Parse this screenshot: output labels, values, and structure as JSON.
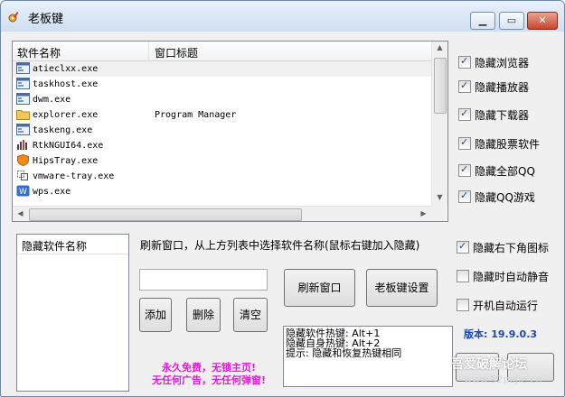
{
  "window": {
    "title": "老板键"
  },
  "process_list": {
    "columns": [
      "软件名称",
      "窗口标题"
    ],
    "rows": [
      {
        "name": "atieclxx.exe",
        "title": "",
        "icon": "app-window-icon"
      },
      {
        "name": "taskhost.exe",
        "title": "",
        "icon": "app-window-icon"
      },
      {
        "name": "dwm.exe",
        "title": "",
        "icon": "app-window-icon"
      },
      {
        "name": "explorer.exe",
        "title": "Program Manager",
        "icon": "folder-icon"
      },
      {
        "name": "taskeng.exe",
        "title": "",
        "icon": "app-window-icon"
      },
      {
        "name": "RtkNGUI64.exe",
        "title": "",
        "icon": "audio-icon"
      },
      {
        "name": "HipsTray.exe",
        "title": "",
        "icon": "shield-icon"
      },
      {
        "name": "vmware-tray.exe",
        "title": "",
        "icon": "vmware-icon"
      },
      {
        "name": "wps.exe",
        "title": "",
        "icon": "wps-icon"
      }
    ]
  },
  "options": {
    "hide_browser": {
      "label": "隐藏浏览器",
      "checked": true
    },
    "hide_player": {
      "label": "隐藏播放器",
      "checked": true
    },
    "hide_downloader": {
      "label": "隐藏下载器",
      "checked": true
    },
    "hide_stock": {
      "label": "隐藏股票软件",
      "checked": true
    },
    "hide_all_qq": {
      "label": "隐藏全部QQ",
      "checked": true
    },
    "hide_qq_game": {
      "label": "隐藏QQ游戏",
      "checked": true
    },
    "hide_tray_icon": {
      "label": "隐藏右下角图标",
      "checked": true
    },
    "auto_mute": {
      "label": "隐藏时自动静音",
      "checked": false
    },
    "autostart": {
      "label": "开机自动运行",
      "checked": false
    }
  },
  "hidden_list": {
    "header": "隐藏软件名称"
  },
  "hint_text": "刷新窗口，从上方列表中选择软件名称(鼠标右键加入隐藏)",
  "buttons": {
    "add": "添加",
    "delete": "删除",
    "clear": "清空",
    "refresh": "刷新窗口",
    "boss_key_settings": "老板键设置"
  },
  "hotkeys": {
    "line1": "隐藏软件热键: Alt+1",
    "line2": "隐藏自身热键: Alt+2",
    "line3": "提示: 隐藏和恢复热键相同"
  },
  "promo": {
    "line1": "永久免费，无锁主页!",
    "line2": "无任何广告，无任何弹窗!"
  },
  "version": "版本: 19.9.0.3",
  "watermark": {
    "text": "吾爱破解论坛",
    "url": "www.52pojie.cn"
  },
  "colors": {
    "promo": "#e21bd9",
    "version": "#1f48a8",
    "close": "#c7452c"
  }
}
